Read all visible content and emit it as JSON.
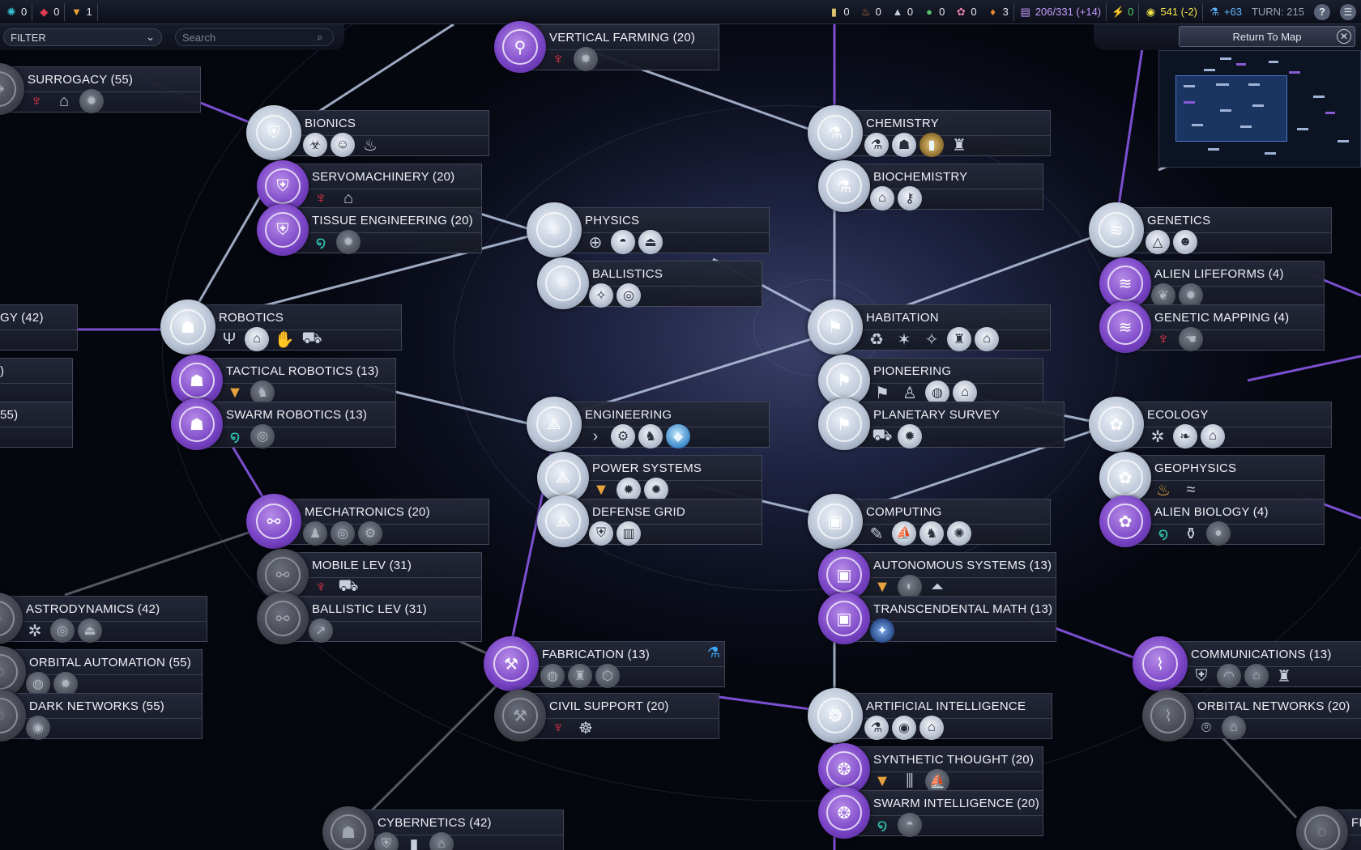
{
  "topbar": {
    "left_counters": [
      {
        "icon": "affinity-harmony-icon",
        "value": "0",
        "color": "#39c6d6"
      },
      {
        "icon": "affinity-purity-icon",
        "value": "0",
        "color": "#e2384e"
      },
      {
        "icon": "affinity-supremacy-icon",
        "value": "1",
        "color": "#f0a03a"
      }
    ],
    "resources": [
      {
        "icon": "petroleum-icon",
        "value": "0"
      },
      {
        "icon": "geothermal-icon",
        "value": "0"
      },
      {
        "icon": "titanium-icon",
        "value": "0"
      },
      {
        "icon": "floatstone-icon",
        "value": "0"
      },
      {
        "icon": "xenomass-icon",
        "value": "0"
      },
      {
        "icon": "firaxite-icon",
        "value": "3"
      }
    ],
    "culture": "206/331 (+14)",
    "health": "0",
    "energy": "541 (-2)",
    "science": "+63",
    "turn": "TURN: 215",
    "help_label": "?",
    "menu_label": "☰"
  },
  "filter": {
    "label": "FILTER",
    "search_placeholder": "Search"
  },
  "return_to_map": "Return To Map",
  "nodes": {
    "vertical_farming": "VERTICAL FARMING (20)",
    "surrogacy": "SURROGACY (55)",
    "bionics": "BIONICS",
    "servomachinery": "SERVOMACHINERY (20)",
    "tissue_engineering": "TISSUE ENGINEERING (20)",
    "physics": "PHYSICS",
    "ballistics": "BALLISTICS",
    "chemistry": "CHEMISTRY",
    "biochemistry": "BIOCHEMISTRY",
    "genetics": "GENETICS",
    "alien_lifeforms": "ALIEN LIFEFORMS (4)",
    "genetic_mapping": "GENETIC MAPPING (4)",
    "left_partial_1": "GY (42)",
    "left_partial_2": ")",
    "left_partial_3": "55)",
    "robotics": "ROBOTICS",
    "tactical_robotics": "TACTICAL ROBOTICS (13)",
    "swarm_robotics": "SWARM ROBOTICS (13)",
    "habitation": "HABITATION",
    "pioneering": "PIONEERING",
    "planetary_survey": "PLANETARY SURVEY",
    "engineering": "ENGINEERING",
    "power_systems": "POWER SYSTEMS",
    "defense_grid": "DEFENSE GRID",
    "ecology": "ECOLOGY",
    "geophysics": "GEOPHYSICS",
    "alien_biology": "ALIEN BIOLOGY (4)",
    "mechatronics": "MECHATRONICS (20)",
    "mobile_lev": "MOBILE LEV (31)",
    "ballistic_lev": "BALLISTIC LEV (31)",
    "computing": "COMPUTING",
    "autonomous_systems": "AUTONOMOUS SYSTEMS (13)",
    "transcendental_math": "TRANSCENDENTAL MATH (13)",
    "astrodynamics": "ASTRODYNAMICS (42)",
    "orbital_automation": "ORBITAL AUTOMATION (55)",
    "dark_networks": "DARK NETWORKS (55)",
    "fabrication": "FABRICATION (13)",
    "civil_support": "CIVIL SUPPORT (20)",
    "communications": "COMMUNICATIONS (13)",
    "orbital_networks": "ORBITAL NETWORKS (20)",
    "artificial_intelligence": "ARTIFICIAL INTELLIGENCE",
    "synthetic_thought": "SYNTHETIC THOUGHT (20)",
    "swarm_intelligence": "SWARM INTELLIGENCE (20)",
    "cybernetics": "CYBERNETICS (42)",
    "right_partial": "FI"
  },
  "colors": {
    "researched": "#b9c4d6",
    "available": "#7a45c6",
    "locked": "#40434d",
    "link_researched": "#b8c6e0",
    "link_available": "#7b4fd0",
    "link_locked": "#6a6e78"
  }
}
